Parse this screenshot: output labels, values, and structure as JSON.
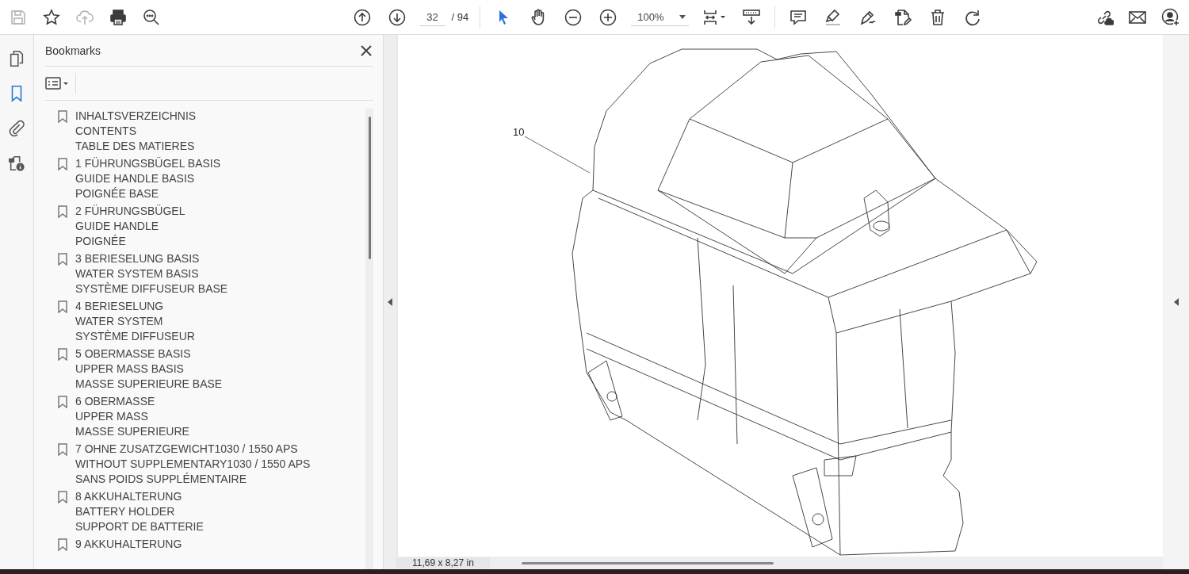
{
  "toolbar": {
    "tools_left": [
      {
        "kind": "save",
        "disabled": true
      },
      {
        "kind": "star",
        "disabled": false
      },
      {
        "kind": "upload",
        "disabled": true
      },
      {
        "kind": "print",
        "disabled": false
      },
      {
        "kind": "search",
        "disabled": false
      }
    ],
    "page_number": "32",
    "page_count": "/ 94",
    "zoom": "100%",
    "tools_mid": [
      {
        "kind": "select",
        "selected": true
      },
      {
        "kind": "hand",
        "selected": false
      },
      {
        "kind": "zoom-out",
        "selected": false
      },
      {
        "kind": "zoom-in",
        "selected": false
      }
    ],
    "tools_right": [
      {
        "kind": "comment"
      },
      {
        "kind": "highlight"
      },
      {
        "kind": "sign"
      },
      {
        "kind": "edit"
      },
      {
        "kind": "delete"
      },
      {
        "kind": "rotate"
      }
    ],
    "tools_far": [
      {
        "kind": "share-link"
      },
      {
        "kind": "mail"
      },
      {
        "kind": "add-user"
      }
    ]
  },
  "rail": [
    {
      "kind": "pages",
      "selected": false
    },
    {
      "kind": "bookmarks",
      "selected": true
    },
    {
      "kind": "attachments",
      "selected": false
    },
    {
      "kind": "info",
      "selected": false
    }
  ],
  "bookmarks_panel": {
    "title": "Bookmarks",
    "items": [
      {
        "lines": [
          "INHALTSVERZEICHNIS",
          "CONTENTS",
          "TABLE DES MATIERES"
        ]
      },
      {
        "lines": [
          "1 FÜHRUNGSBÜGEL BASIS",
          "GUIDE HANDLE BASIS",
          "POIGNÉE BASE"
        ]
      },
      {
        "lines": [
          "2 FÜHRUNGSBÜGEL",
          "GUIDE HANDLE",
          "POIGNÉE"
        ]
      },
      {
        "lines": [
          "3 BERIESELUNG BASIS",
          "WATER SYSTEM BASIS",
          "SYSTÈME DIFFUSEUR BASE"
        ]
      },
      {
        "lines": [
          "4 BERIESELUNG",
          "WATER SYSTEM",
          "SYSTÈME DIFFUSEUR"
        ]
      },
      {
        "lines": [
          "5 OBERMASSE BASIS",
          "UPPER MASS BASIS",
          "MASSE SUPERIEURE BASE"
        ]
      },
      {
        "lines": [
          "6 OBERMASSE",
          "UPPER MASS",
          "MASSE SUPERIEURE"
        ]
      },
      {
        "lines": [
          "7 OHNE ZUSATZGEWICHT1030 / 1550 APS",
          "WITHOUT SUPPLEMENTARY1030 / 1550 APS",
          "SANS POIDS SUPPLÉMENTAIRE"
        ]
      },
      {
        "lines": [
          "8 AKKUHALTERUNG",
          "BATTERY HOLDER",
          "SUPPORT DE BATTERIE"
        ]
      },
      {
        "lines": [
          "9 AKKUHALTERUNG"
        ]
      }
    ]
  },
  "document": {
    "callout": "10"
  },
  "status_bar": {
    "page_size": "11,69 x 8,27 in"
  }
}
